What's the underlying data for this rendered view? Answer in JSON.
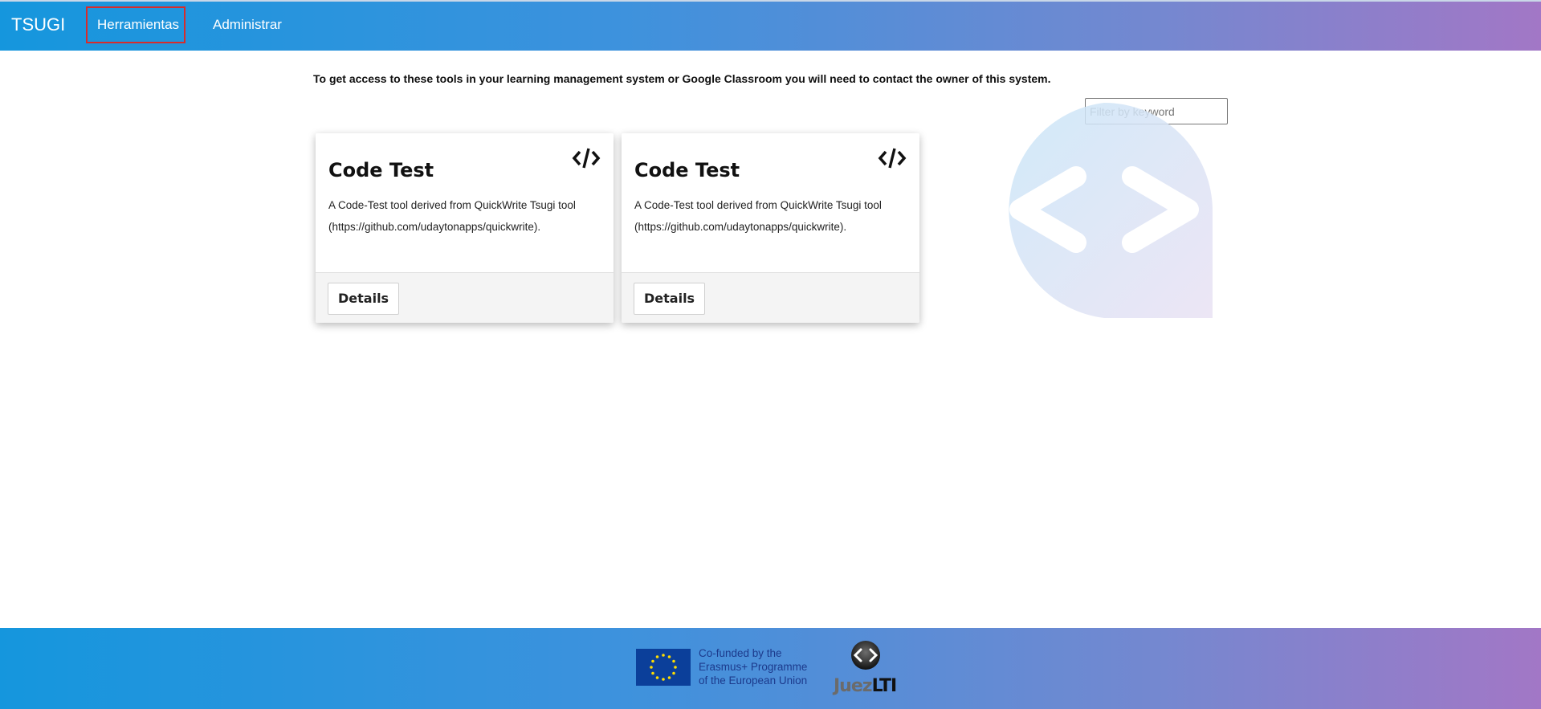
{
  "nav": {
    "brand": "TSUGI",
    "items": [
      {
        "label": "Herramientas"
      },
      {
        "label": "Administrar"
      }
    ]
  },
  "main": {
    "notice": "To get access to these tools in your learning management system or Google Classroom you will need to contact the owner of this system.",
    "filter_placeholder": "Filter by keyword",
    "cards": [
      {
        "icon": "code-icon",
        "title": "Code Test",
        "description": "A Code-Test tool derived from QuickWrite Tsugi tool (https://github.com/udaytonapps/quickwrite).",
        "button": "Details"
      },
      {
        "icon": "code-icon",
        "title": "Code Test",
        "description": "A Code-Test tool derived from QuickWrite Tsugi tool (https://github.com/udaytonapps/quickwrite).",
        "button": "Details"
      }
    ]
  },
  "footer": {
    "eu_text": "Co-funded by the Erasmus+ Programme of the European Union",
    "juez_word_a": "Juez",
    "juez_word_b": "LTI"
  },
  "colors": {
    "gradient_start": "#1596dd",
    "gradient_end": "#a277c6",
    "highlight": "#d82b2b"
  }
}
